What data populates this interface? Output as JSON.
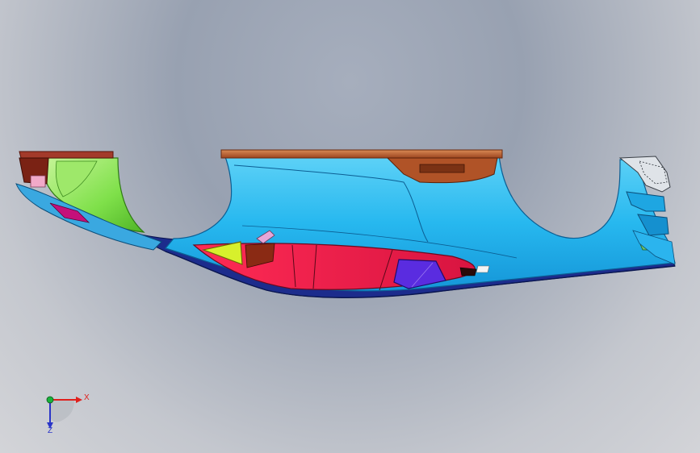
{
  "viewport": {
    "background_top": "#98a1b1",
    "background_bottom": "#d3d4d8"
  },
  "model": {
    "part_colors": {
      "main_body": "#27b8ef",
      "main_body_highlight": "#5fd2f7",
      "top_rim": "#b85a2b",
      "left_green_panel": "#7fe04a",
      "red_inner_panel": "#ee1a45",
      "purple_insert": "#5a2ce0",
      "yellow_triangle": "#d7f02c",
      "dark_navy_band": "#1c2c8c",
      "magenta_detail": "#c4107a"
    }
  },
  "triad": {
    "x_label": "X",
    "z_label": "Z",
    "x_color": "#e0201c",
    "y_color": "#19b23b",
    "z_color": "#2a35c8"
  }
}
